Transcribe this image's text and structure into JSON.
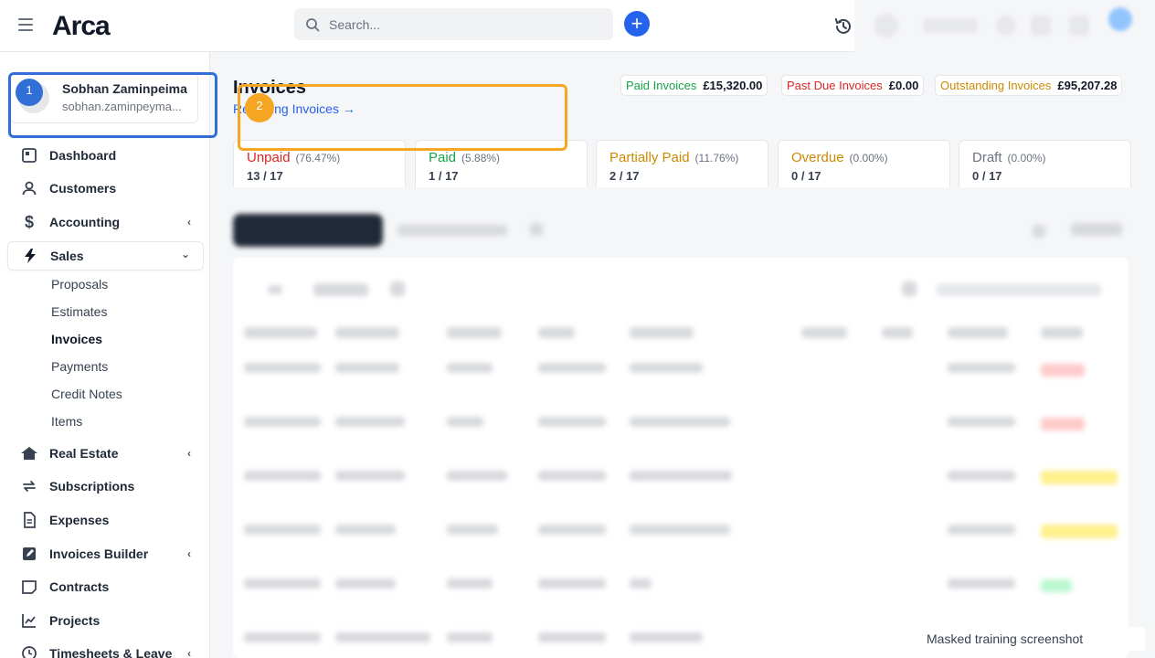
{
  "app": {
    "logo_text": "Arca",
    "accent": "#2563eb",
    "logo_accent": "#f97316"
  },
  "search": {
    "placeholder": "Search..."
  },
  "profile": {
    "name": "Sobhan Zaminpeima",
    "email": "sobhan.zaminpeyma..."
  },
  "sidebar": {
    "items": [
      {
        "label": "Dashboard",
        "icon": "dashboard-icon"
      },
      {
        "label": "Customers",
        "icon": "user-icon"
      },
      {
        "label": "Accounting",
        "icon": "dollar-icon",
        "chevron": "left"
      },
      {
        "label": "Sales",
        "icon": "bolt-icon",
        "chevron": "down",
        "active": true
      },
      {
        "label": "Real Estate",
        "icon": "house-icon",
        "chevron": "left"
      },
      {
        "label": "Subscriptions",
        "icon": "repeat-icon"
      },
      {
        "label": "Expenses",
        "icon": "file-icon"
      },
      {
        "label": "Invoices Builder",
        "icon": "edit-icon",
        "chevron": "left"
      },
      {
        "label": "Contracts",
        "icon": "note-icon"
      },
      {
        "label": "Projects",
        "icon": "chart-icon"
      },
      {
        "label": "Timesheets & Leave",
        "icon": "clock-icon",
        "chevron": "left"
      }
    ],
    "sales_subitems": [
      "Proposals",
      "Estimates",
      "Invoices",
      "Payments",
      "Credit Notes",
      "Items"
    ],
    "current_subitem": "Invoices"
  },
  "page": {
    "title": "Invoices",
    "recurring_link": "Recurring Invoices →"
  },
  "summary": [
    {
      "label": "Paid Invoices",
      "amount": "£15,320.00",
      "color": "#16a34a"
    },
    {
      "label": "Past Due Invoices",
      "amount": "£0.00",
      "color": "#dc2626"
    },
    {
      "label": "Outstanding Invoices",
      "amount": "£95,207.28",
      "color": "#ca8a04"
    }
  ],
  "stats": [
    {
      "title": "Unpaid",
      "pct": "(76.47%)",
      "count": "13 / 17",
      "color": "#dc2626"
    },
    {
      "title": "Paid",
      "pct": "(5.88%)",
      "count": "1 / 17",
      "color": "#16a34a"
    },
    {
      "title": "Partially Paid",
      "pct": "(11.76%)",
      "count": "2 / 17",
      "color": "#ca8a04"
    },
    {
      "title": "Overdue",
      "pct": "(0.00%)",
      "count": "0 / 17",
      "color": "#ca8a04"
    },
    {
      "title": "Draft",
      "pct": "(0.00%)",
      "count": "0 / 17",
      "color": "#6b7280"
    }
  ],
  "annotations": {
    "marker_1": "1",
    "marker_2": "2"
  },
  "watermark": "Masked training screenshot"
}
